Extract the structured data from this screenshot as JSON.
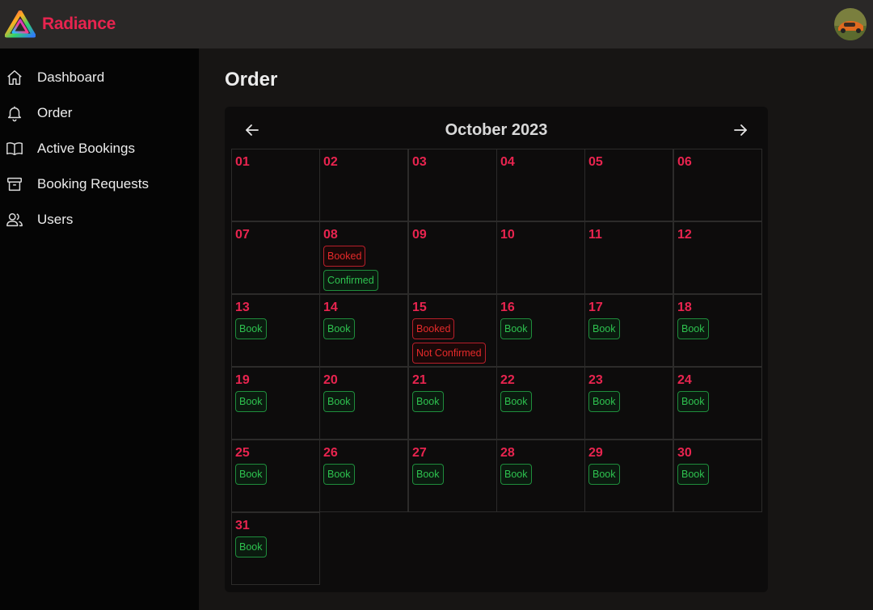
{
  "app": {
    "name": "Radiance"
  },
  "sidebar": {
    "items": [
      {
        "label": "Dashboard",
        "icon": "home-icon"
      },
      {
        "label": "Order",
        "icon": "bell-icon"
      },
      {
        "label": "Active Bookings",
        "icon": "book-open-icon"
      },
      {
        "label": "Booking Requests",
        "icon": "archive-icon"
      },
      {
        "label": "Users",
        "icon": "users-icon"
      }
    ]
  },
  "page": {
    "title": "Order"
  },
  "calendar": {
    "month_label": "October 2023",
    "days": [
      {
        "day": "01",
        "badges": []
      },
      {
        "day": "02",
        "badges": []
      },
      {
        "day": "03",
        "badges": []
      },
      {
        "day": "04",
        "badges": []
      },
      {
        "day": "05",
        "badges": []
      },
      {
        "day": "06",
        "badges": []
      },
      {
        "day": "07",
        "badges": []
      },
      {
        "day": "08",
        "badges": [
          {
            "text": "Booked",
            "color": "red"
          },
          {
            "text": "Confirmed",
            "color": "green"
          }
        ]
      },
      {
        "day": "09",
        "badges": []
      },
      {
        "day": "10",
        "badges": []
      },
      {
        "day": "11",
        "badges": []
      },
      {
        "day": "12",
        "badges": []
      },
      {
        "day": "13",
        "badges": [
          {
            "text": "Book",
            "color": "green"
          }
        ]
      },
      {
        "day": "14",
        "badges": [
          {
            "text": "Book",
            "color": "green"
          }
        ]
      },
      {
        "day": "15",
        "badges": [
          {
            "text": "Booked",
            "color": "red"
          },
          {
            "text": "Not Confirmed",
            "color": "red"
          }
        ]
      },
      {
        "day": "16",
        "badges": [
          {
            "text": "Book",
            "color": "green"
          }
        ]
      },
      {
        "day": "17",
        "badges": [
          {
            "text": "Book",
            "color": "green"
          }
        ]
      },
      {
        "day": "18",
        "badges": [
          {
            "text": "Book",
            "color": "green"
          }
        ]
      },
      {
        "day": "19",
        "badges": [
          {
            "text": "Book",
            "color": "green"
          }
        ]
      },
      {
        "day": "20",
        "badges": [
          {
            "text": "Book",
            "color": "green"
          }
        ]
      },
      {
        "day": "21",
        "badges": [
          {
            "text": "Book",
            "color": "green"
          }
        ]
      },
      {
        "day": "22",
        "badges": [
          {
            "text": "Book",
            "color": "green"
          }
        ]
      },
      {
        "day": "23",
        "badges": [
          {
            "text": "Book",
            "color": "green"
          }
        ]
      },
      {
        "day": "24",
        "badges": [
          {
            "text": "Book",
            "color": "green"
          }
        ]
      },
      {
        "day": "25",
        "badges": [
          {
            "text": "Book",
            "color": "green"
          }
        ]
      },
      {
        "day": "26",
        "badges": [
          {
            "text": "Book",
            "color": "green"
          }
        ]
      },
      {
        "day": "27",
        "badges": [
          {
            "text": "Book",
            "color": "green"
          }
        ]
      },
      {
        "day": "28",
        "badges": [
          {
            "text": "Book",
            "color": "green"
          }
        ]
      },
      {
        "day": "29",
        "badges": [
          {
            "text": "Book",
            "color": "green"
          }
        ]
      },
      {
        "day": "30",
        "badges": [
          {
            "text": "Book",
            "color": "green"
          }
        ]
      },
      {
        "day": "31",
        "badges": [
          {
            "text": "Book",
            "color": "green"
          }
        ]
      }
    ]
  },
  "colors": {
    "accent": "#e8244f",
    "book_green": "#2ec24f",
    "booked_red": "#e62a2a"
  }
}
